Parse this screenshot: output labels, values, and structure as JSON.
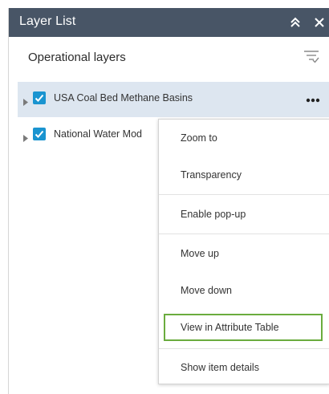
{
  "header": {
    "title": "Layer List",
    "collapse_icon": "double-chevron-up-icon",
    "close_icon": "close-icon",
    "bg_color": "#485566"
  },
  "section": {
    "title": "Operational layers",
    "filter_icon": "filter-list-icon"
  },
  "layers": [
    {
      "label": "USA Coal Bed Methane Basins",
      "checked": true,
      "selected": true
    },
    {
      "label": "National Water Mod",
      "checked": true,
      "selected": false
    }
  ],
  "context_menu": {
    "items": [
      {
        "label": "Zoom to"
      },
      {
        "label": "Transparency"
      },
      {
        "label": "Enable pop-up"
      },
      {
        "label": "Move up"
      },
      {
        "label": "Move down"
      },
      {
        "label": "View in Attribute Table",
        "highlighted": true
      },
      {
        "label": "Show item details"
      }
    ]
  },
  "colors": {
    "checkbox": "#1a94d0",
    "selected_row": "#dde6f0",
    "highlight_border": "#6aac3e"
  }
}
